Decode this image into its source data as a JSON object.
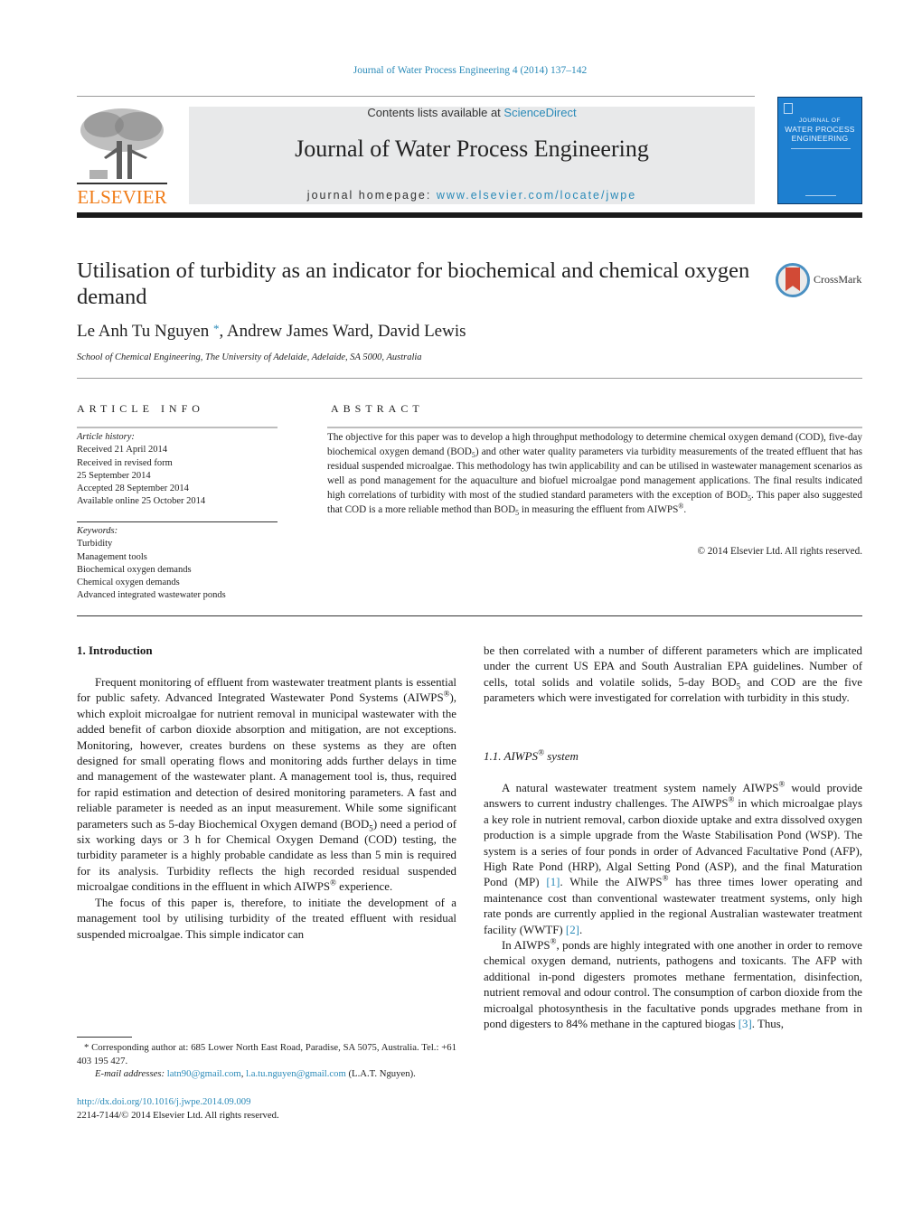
{
  "header": {
    "citation": "Journal of Water Process Engineering 4 (2014) 137–142",
    "contents_prefix": "Contents lists available at ",
    "contents_link": "ScienceDirect",
    "journal_name": "Journal of Water Process Engineering",
    "homepage_prefix": "journal homepage: ",
    "homepage_link": "www.elsevier.com/locate/jwpe",
    "publisher_logo_text": "ELSEVIER",
    "cover": {
      "line1": "JOURNAL OF",
      "line2": "WATER PROCESS",
      "line3": "ENGINEERING",
      "color": "#1d7fd0"
    }
  },
  "article": {
    "title": "Utilisation of turbidity as an indicator for biochemical and chemical oxygen demand",
    "crossmark_label": "CrossMark",
    "authors": {
      "first": "Le Anh Tu Nguyen",
      "corresponding_mark": "*",
      "rest": ", Andrew James Ward, David Lewis"
    },
    "affiliation": "School of Chemical Engineering, The University of Adelaide, Adelaide, SA 5000, Australia"
  },
  "article_info": {
    "heading": "ARTICLE INFO",
    "history_label": "Article history:",
    "history": [
      "Received 21 April 2014",
      "Received in revised form",
      "25 September 2014",
      "Accepted 28 September 2014",
      "Available online 25 October 2014"
    ],
    "keywords_label": "Keywords:",
    "keywords": [
      "Turbidity",
      "Management tools",
      "Biochemical oxygen demands",
      "Chemical oxygen demands",
      "Advanced integrated wastewater ponds"
    ]
  },
  "abstract": {
    "heading": "ABSTRACT",
    "part1": "The objective for this paper was to develop a high throughput methodology to determine chemical oxygen demand (COD), five-day biochemical oxygen demand (BOD",
    "sub1": "5",
    "part2": ") and other water quality parameters via turbidity measurements of the treated effluent that has residual suspended microalgae. This methodology has twin applicability and can be utilised in wastewater management scenarios as well as pond management for the aquaculture and biofuel microalgae pond management applications. The final results indicated high correlations of turbidity with most of the studied standard parameters with the exception of BOD",
    "sub2": "5",
    "part3": ". This paper also suggested that COD is a more reliable method than BOD",
    "sub3": "5",
    "part4": " in measuring the effluent from AIWPS",
    "sup": "®",
    "part5": ".",
    "copyright": "© 2014 Elsevier Ltd. All rights reserved."
  },
  "body": {
    "intro_heading": "1.  Introduction",
    "p1a": "Frequent monitoring of effluent from wastewater treatment plants is essential for public safety. Advanced Integrated Wastewater Pond Systems (AIWPS",
    "p1b": "), which exploit microalgae for nutrient removal in municipal wastewater with the added benefit of carbon dioxide absorption and mitigation, are not exceptions. Monitoring, however, creates burdens on these systems as they are often designed for small operating flows and monitoring adds further delays in time and management of the wastewater plant. A management tool is, thus, required for rapid estimation and detection of desired monitoring parameters. A fast and reliable parameter is needed as an input measurement. While some significant parameters such as 5-day Biochemical Oxygen demand (BOD",
    "p1c": ") need a period of six working days or 3 h for Chemical Oxygen Demand (COD) testing, the turbidity parameter is a highly probable candidate as less than 5 min is required for its analysis. Turbidity reflects the high recorded residual suspended microalgae conditions in the effluent in which AIWPS",
    "p1d": " experience.",
    "p2": "The focus of this paper is, therefore, to initiate the development of a management tool by utilising turbidity of the treated effluent with residual suspended microalgae. This simple indicator can",
    "col2_cont_a": "be then correlated with a number of different parameters which are implicated under the current US EPA and South Australian EPA guidelines. Number of cells, total solids and volatile solids, 5-day BOD",
    "col2_cont_b": " and COD are the five parameters which were investigated for correlation with turbidity in this study.",
    "sub_heading_a": "1.1.  AIWPS",
    "sub_heading_b": " system",
    "p3a": "A natural wastewater treatment system namely AIWPS",
    "p3b": " would provide answers to current industry challenges. The AIWPS",
    "p3c": " in which microalgae plays a key role in nutrient removal, carbon dioxide uptake and extra dissolved oxygen production is a simple upgrade from the Waste Stabilisation Pond (WSP). The system is a series of four ponds in order of Advanced Facultative Pond (AFP), High Rate Pond (HRP), Algal Setting Pond (ASP), and the final Maturation Pond (MP) ",
    "ref1": "[1]",
    "p3d": ". While the AIWPS",
    "p3e": " has three times lower operating and maintenance cost than conventional wastewater treatment systems, only high rate ponds are currently applied in the regional Australian wastewater treatment facility (WWTF) ",
    "ref2": "[2]",
    "p3f": ".",
    "p4a": "In AIWPS",
    "p4b": ", ponds are highly integrated with one another in order to remove chemical oxygen demand, nutrients, pathogens and toxicants. The AFP with additional in-pond digesters promotes methane fermentation, disinfection, nutrient removal and odour control. The consumption of carbon dioxide from the microalgal photosynthesis in the facultative ponds upgrades methane from in pond digesters to 84% methane in the captured biogas ",
    "ref3": "[3]",
    "p4c": ". Thus,",
    "reg": "®",
    "sub5": "5"
  },
  "footnote": {
    "corresponding": "* Corresponding author at: 685 Lower North East Road, Paradise, SA 5075, Australia. Tel.: +61 403 195 427.",
    "email_label": "E-mail addresses: ",
    "email1": "latn90@gmail.com",
    "email_sep": ", ",
    "email2": "l.a.tu.nguyen@gmail.com",
    "email_suffix": " (L.A.T. Nguyen).",
    "doi": "http://dx.doi.org/10.1016/j.jwpe.2014.09.009",
    "issn": "2214-7144/© 2014 Elsevier Ltd. All rights reserved."
  },
  "colors": {
    "link": "#2a8ab8",
    "elsevier_orange": "#f07d1a",
    "header_bg": "#e8e9ea"
  }
}
